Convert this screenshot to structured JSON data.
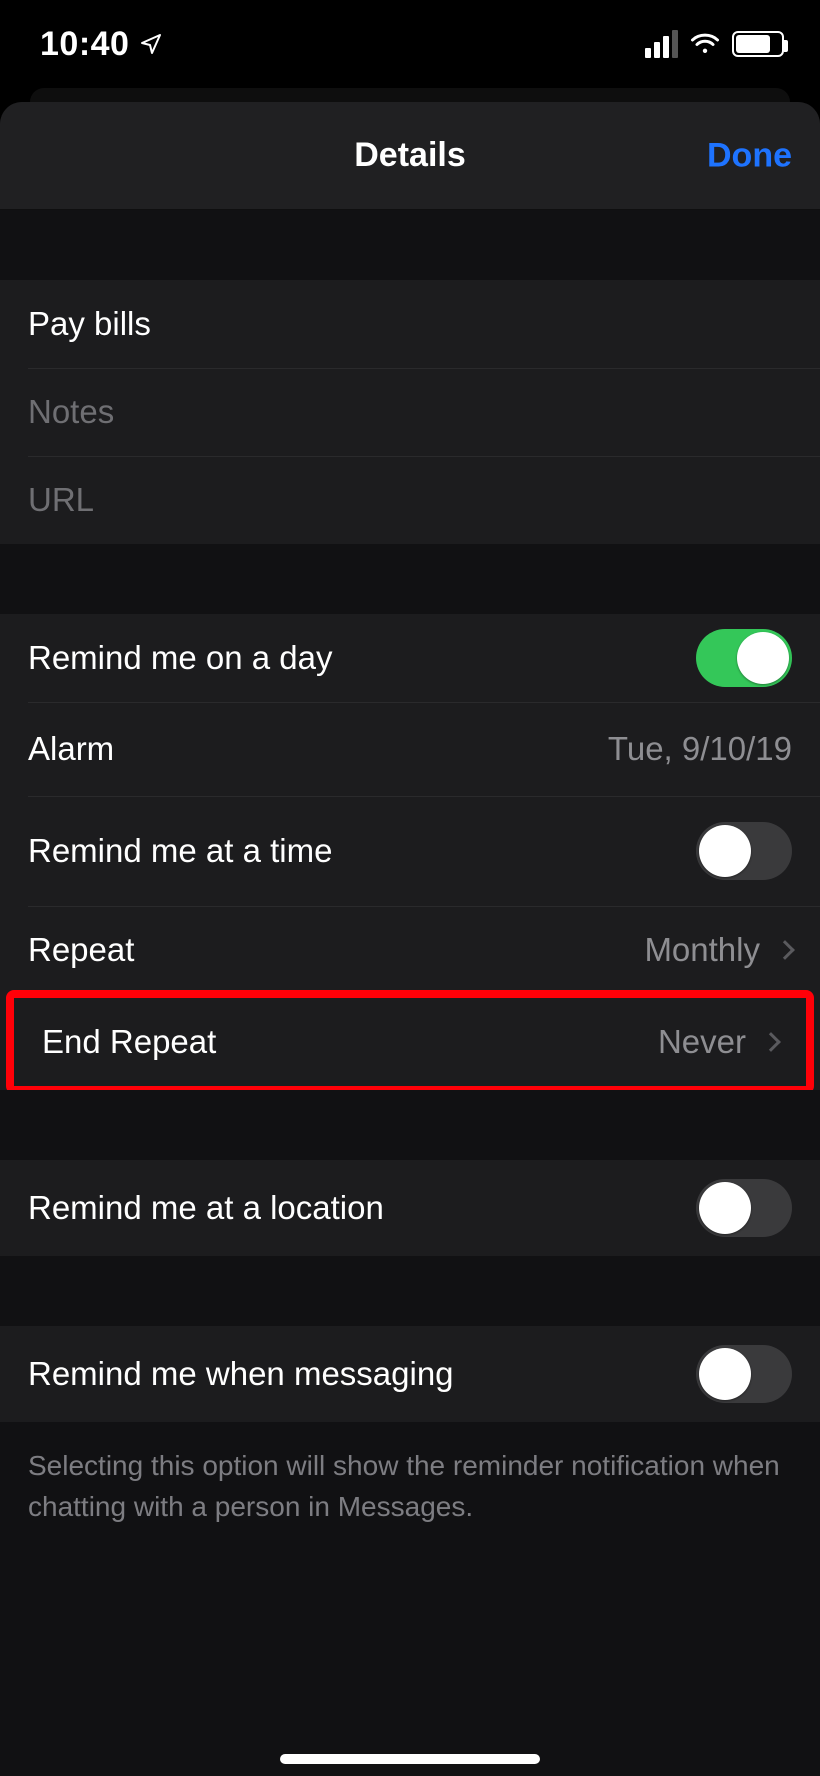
{
  "status": {
    "time": "10:40"
  },
  "nav": {
    "title": "Details",
    "done": "Done"
  },
  "fields": {
    "title_value": "Pay bills",
    "notes_placeholder": "Notes",
    "url_placeholder": "URL"
  },
  "reminders": {
    "day_label": "Remind me on a day",
    "day_on": true,
    "alarm_label": "Alarm",
    "alarm_value": "Tue, 9/10/19",
    "time_label": "Remind me at a time",
    "time_on": false,
    "repeat_label": "Repeat",
    "repeat_value": "Monthly",
    "end_repeat_label": "End Repeat",
    "end_repeat_value": "Never"
  },
  "location": {
    "label": "Remind me at a location",
    "on": false
  },
  "messaging": {
    "label": "Remind me when messaging",
    "on": false,
    "footer": "Selecting this option will show the reminder notification when chatting with a person in Messages."
  }
}
